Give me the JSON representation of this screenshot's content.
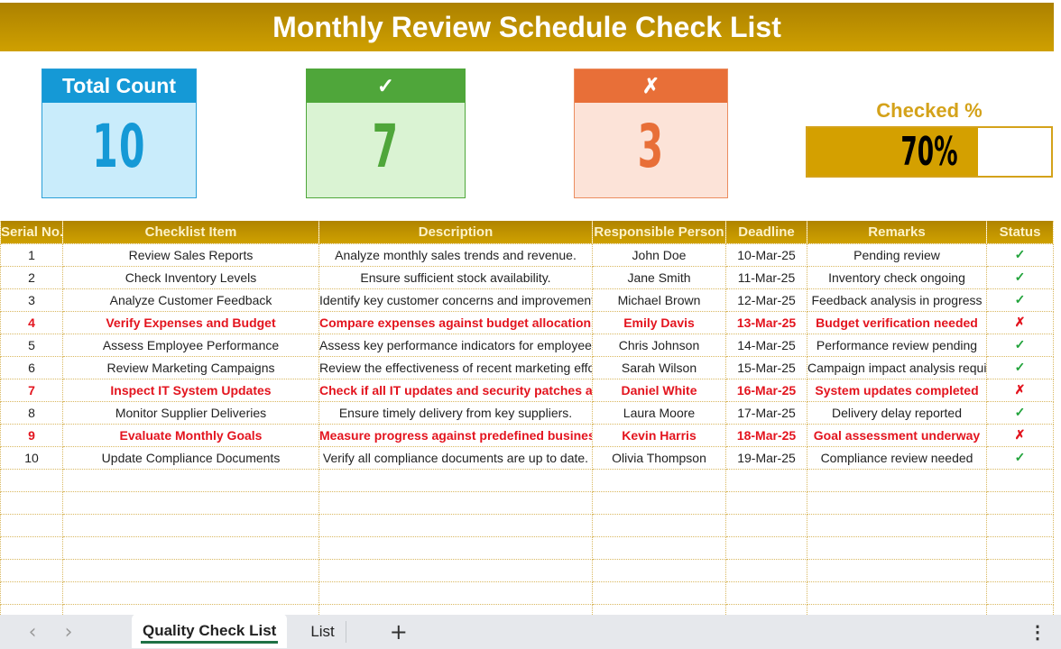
{
  "title": "Monthly Review Schedule Check List",
  "cards": {
    "total": {
      "label": "Total Count",
      "value": "10",
      "color": "#1599d6"
    },
    "checked": {
      "label": "✓",
      "icon": "check-icon",
      "value": "7",
      "color": "#4fa63a"
    },
    "unchecked": {
      "label": "✗",
      "icon": "cross-icon",
      "value": "3",
      "color": "#e86f38"
    }
  },
  "progress": {
    "label": "Checked %",
    "value_text": "70%",
    "fraction": 0.7,
    "color": "#d4a000"
  },
  "table": {
    "headers": [
      "Serial No.",
      "Checklist Item",
      "Description",
      "Responsible Person",
      "Deadline",
      "Remarks",
      "Status"
    ],
    "rows": [
      {
        "serial": "1",
        "item": "Review Sales Reports",
        "description": "Analyze monthly sales trends and revenue.",
        "person": "John Doe",
        "deadline": "10-Mar-25",
        "remarks": "Pending review",
        "status": "✓",
        "status_type": "ok"
      },
      {
        "serial": "2",
        "item": "Check Inventory Levels",
        "description": "Ensure sufficient stock availability.",
        "person": "Jane Smith",
        "deadline": "11-Mar-25",
        "remarks": "Inventory check ongoing",
        "status": "✓",
        "status_type": "ok"
      },
      {
        "serial": "3",
        "item": "Analyze Customer Feedback",
        "description": "Identify key customer concerns and improvements",
        "person": "Michael Brown",
        "deadline": "12-Mar-25",
        "remarks": "Feedback analysis in progress",
        "status": "✓",
        "status_type": "ok"
      },
      {
        "serial": "4",
        "item": "Verify Expenses and Budget",
        "description": "Compare expenses against budget allocations.",
        "person": "Emily Davis",
        "deadline": "13-Mar-25",
        "remarks": "Budget verification needed",
        "status": "✗",
        "status_type": "bad"
      },
      {
        "serial": "5",
        "item": "Assess Employee Performance",
        "description": "Assess key performance indicators for employees.",
        "person": "Chris Johnson",
        "deadline": "14-Mar-25",
        "remarks": "Performance review pending",
        "status": "✓",
        "status_type": "ok"
      },
      {
        "serial": "6",
        "item": "Review Marketing Campaigns",
        "description": "Review the effectiveness of recent marketing efforts",
        "person": "Sarah Wilson",
        "deadline": "15-Mar-25",
        "remarks": "Campaign impact analysis required",
        "status": "✓",
        "status_type": "ok"
      },
      {
        "serial": "7",
        "item": "Inspect IT System Updates",
        "description": "Check if all IT updates and security patches are applied",
        "person": "Daniel White",
        "deadline": "16-Mar-25",
        "remarks": "System updates completed",
        "status": "✗",
        "status_type": "bad"
      },
      {
        "serial": "8",
        "item": "Monitor Supplier Deliveries",
        "description": "Ensure timely delivery from key suppliers.",
        "person": "Laura Moore",
        "deadline": "17-Mar-25",
        "remarks": "Delivery delay reported",
        "status": "✓",
        "status_type": "ok"
      },
      {
        "serial": "9",
        "item": "Evaluate Monthly Goals",
        "description": "Measure progress against predefined business goals",
        "person": "Kevin Harris",
        "deadline": "18-Mar-25",
        "remarks": "Goal assessment underway",
        "status": "✗",
        "status_type": "bad"
      },
      {
        "serial": "10",
        "item": "Update Compliance Documents",
        "description": "Verify all compliance documents are up to date.",
        "person": "Olivia Thompson",
        "deadline": "19-Mar-25",
        "remarks": "Compliance review needed",
        "status": "✓",
        "status_type": "ok"
      }
    ],
    "empty_rows": 7
  },
  "sheet_tabs": {
    "prev_icon": "‹",
    "next_icon": "›",
    "tabs": [
      "Quality Check List",
      "List"
    ],
    "active": 0,
    "add_label": "+",
    "more_label": "⋮"
  }
}
